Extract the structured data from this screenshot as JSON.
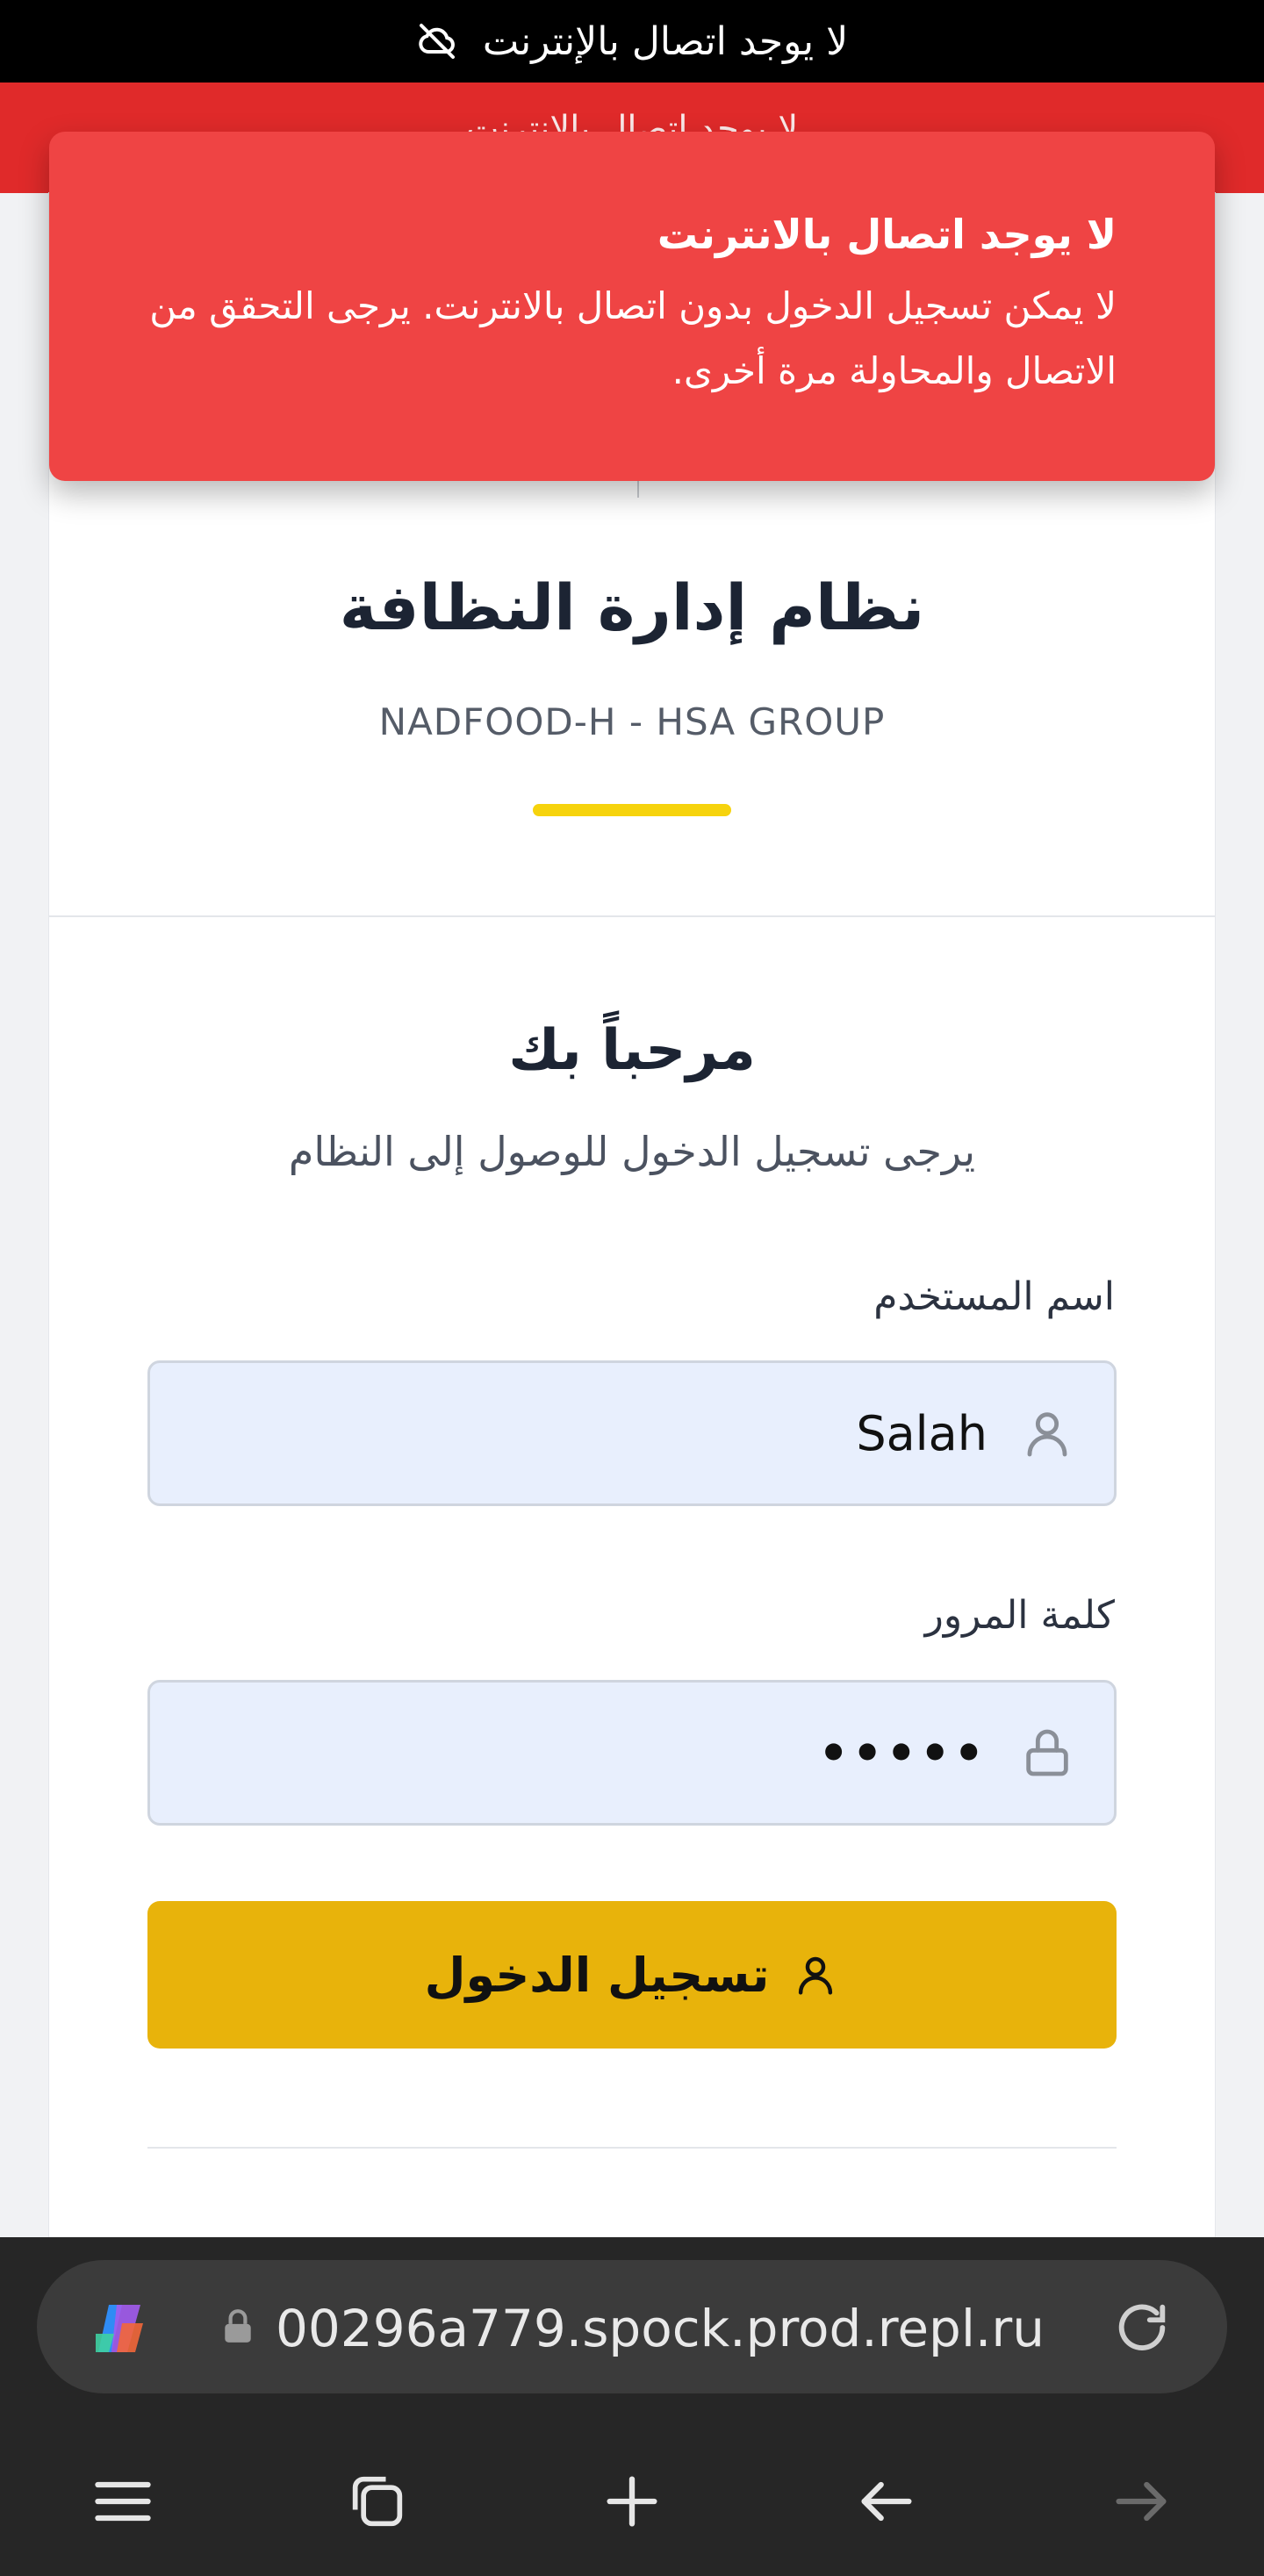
{
  "status_bar": {
    "text": "لا يوجد اتصال بالإنترنت",
    "icon": "cloud-off-icon"
  },
  "banner_ghost": "لا يوجد اتصال بالإنترنت",
  "toast": {
    "title": "لا يوجد اتصال بالانترنت",
    "message": "لا يمكن تسجيل الدخول بدون اتصال بالانترنت. يرجى التحقق من الاتصال والمحاولة مرة أخرى.",
    "color": "#ef4444"
  },
  "header": {
    "title": "نظام إدارة النظافة",
    "subtitle": "NADFOOD-H - HSA GROUP",
    "accent_color": "#f6d30d"
  },
  "login": {
    "welcome": "مرحباً بك",
    "instructions": "يرجى تسجيل الدخول للوصول إلى النظام",
    "username_label": "اسم المستخدم",
    "username_value": "Salah",
    "username_icon": "user-icon",
    "password_label": "كلمة المرور",
    "password_value": "•••••",
    "password_icon": "lock-icon",
    "submit_label": "تسجيل الدخول",
    "submit_icon": "user-icon",
    "button_color": "#e8b30b"
  },
  "browser": {
    "url": "00296a779.spock.prod.repl.ru",
    "icons": [
      "copilot-icon",
      "lock-icon",
      "reload-icon",
      "menu-icon",
      "tabs-icon",
      "plus-icon",
      "back-arrow-icon",
      "forward-arrow-icon"
    ]
  }
}
